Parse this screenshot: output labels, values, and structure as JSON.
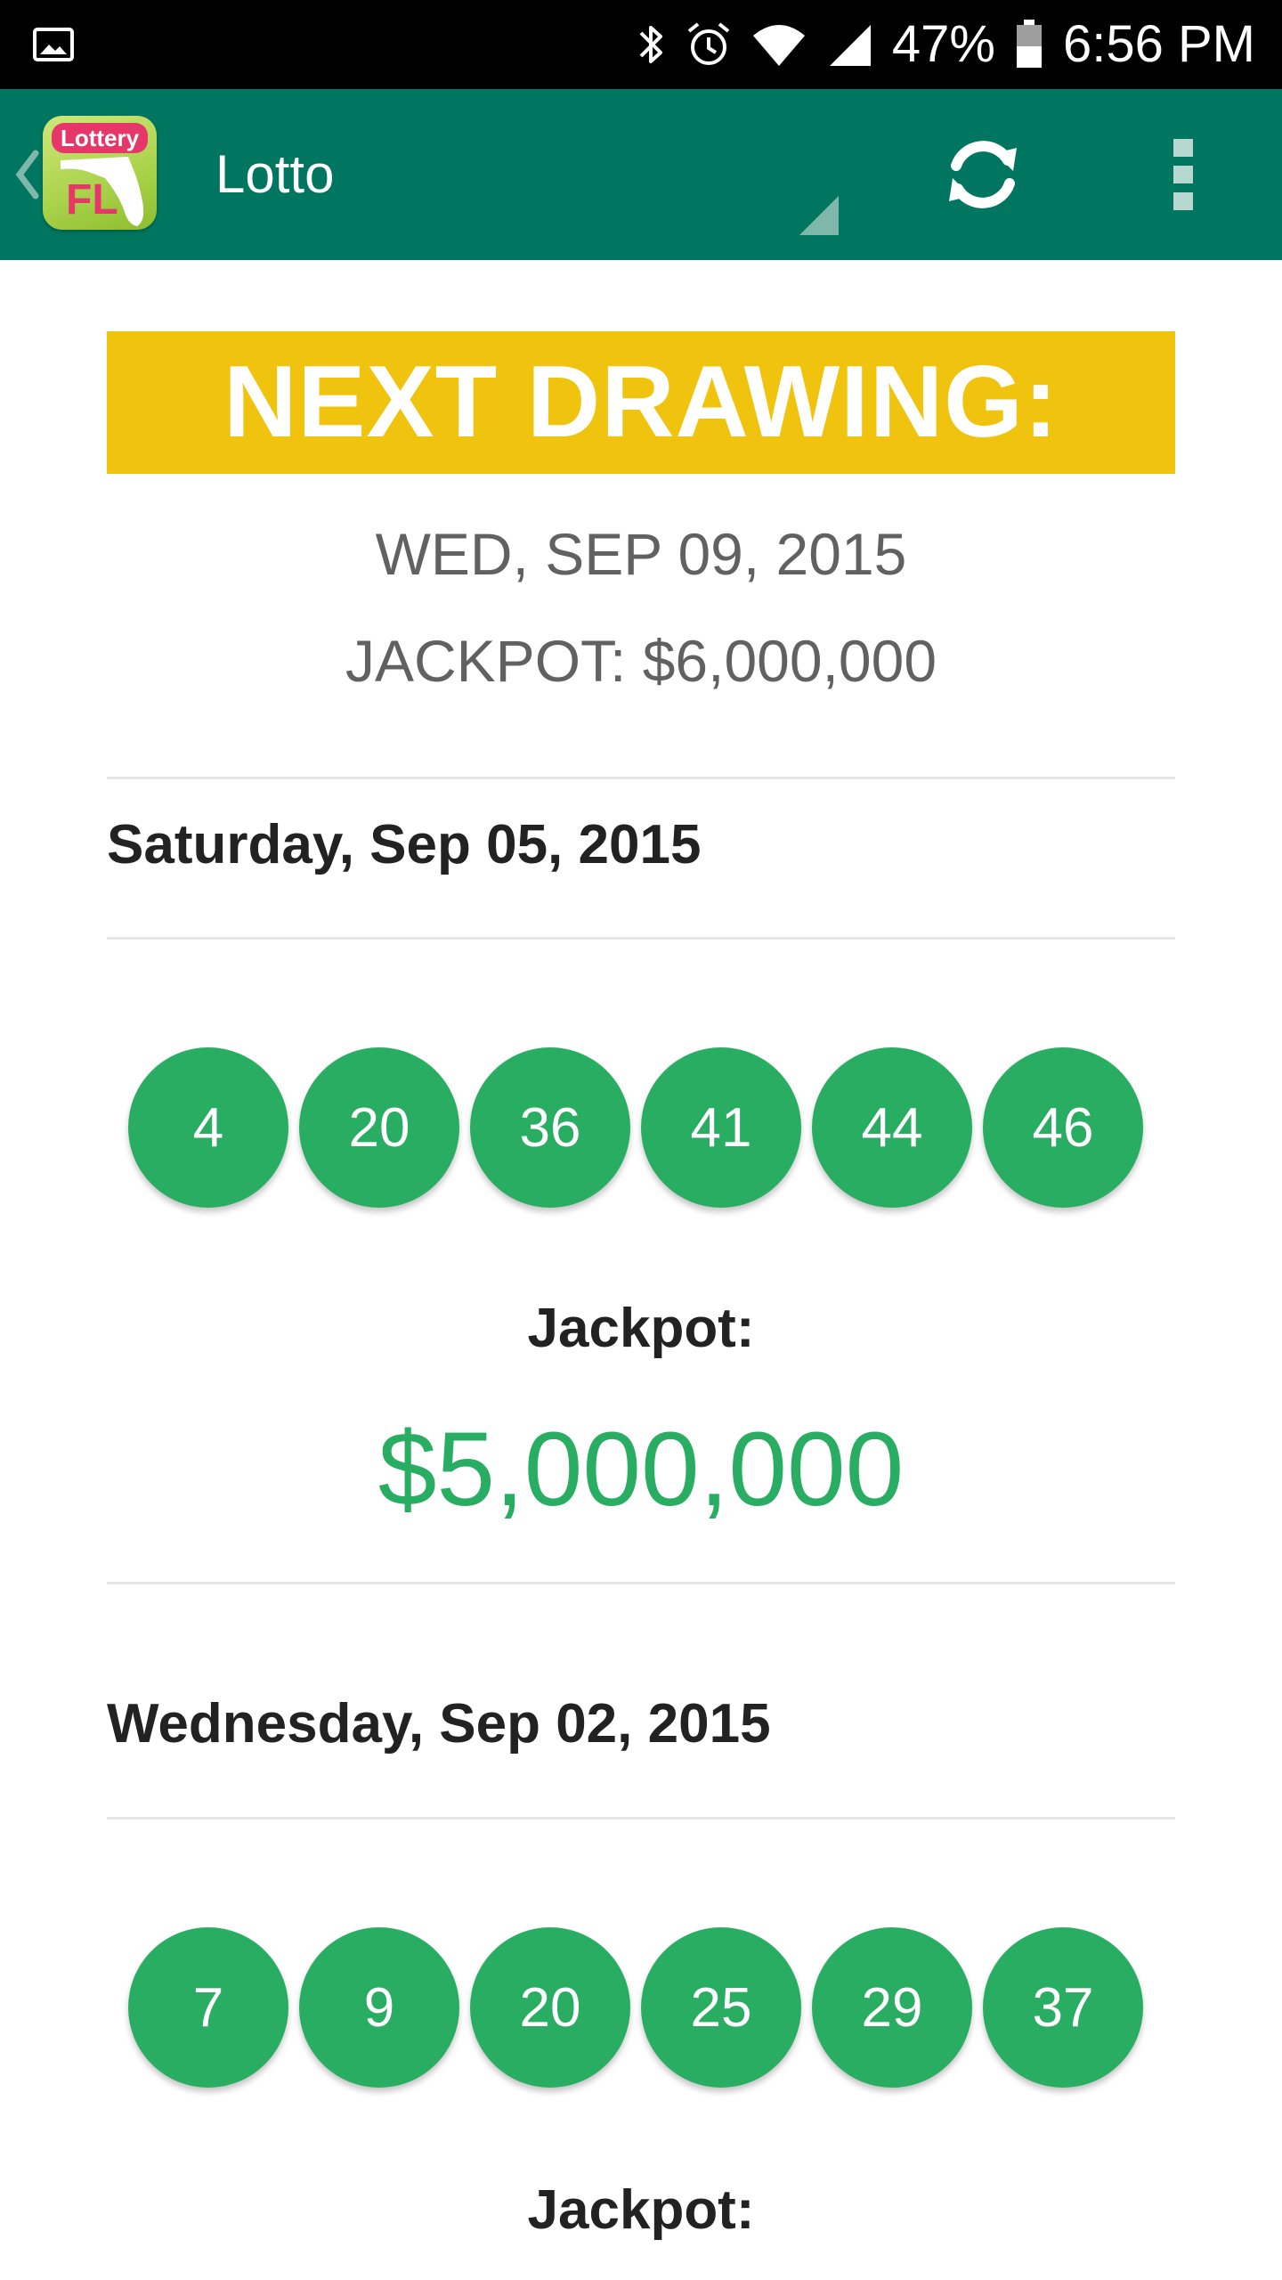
{
  "status_bar": {
    "battery_percent": "47%",
    "time": "6:56 PM",
    "icons": [
      "gallery-icon",
      "bluetooth-icon",
      "alarm-icon",
      "wifi-icon",
      "cell-signal-icon",
      "battery-icon"
    ]
  },
  "app_bar": {
    "logo_top_text": "Lottery",
    "logo_bottom_text": "FL",
    "title": "Lotto",
    "icons": [
      "back-chevron-icon",
      "refresh-icon",
      "overflow-menu-icon"
    ]
  },
  "next_drawing": {
    "heading": "NEXT DRAWING:",
    "date": "WED, SEP 09, 2015",
    "jackpot": "JACKPOT: $6,000,000"
  },
  "results": [
    {
      "date": "Saturday, Sep 05, 2015",
      "numbers": [
        "4",
        "20",
        "36",
        "41",
        "44",
        "46"
      ],
      "jackpot_label": "Jackpot:",
      "jackpot_amount": "$5,000,000"
    },
    {
      "date": "Wednesday, Sep 02, 2015",
      "numbers": [
        "7",
        "9",
        "20",
        "25",
        "29",
        "37"
      ],
      "jackpot_label": "Jackpot:"
    }
  ],
  "colors": {
    "app_bar": "#00755f",
    "banner": "#f0c30f",
    "ball": "#29ad62",
    "jackpot_amount": "#29ad62",
    "muted_text": "#616161"
  }
}
